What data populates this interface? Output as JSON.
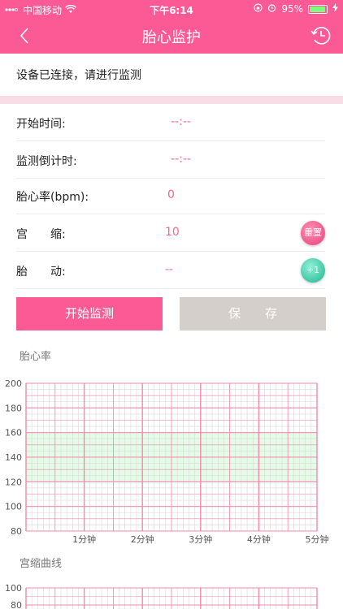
{
  "status_bar": {
    "carrier": "中国移动",
    "time": "下午6:14",
    "battery_percent": "95%",
    "battery_level": 0.95
  },
  "nav": {
    "title": "胎心监护",
    "back_icon": "chevron-left-icon",
    "history_icon": "history-clock-icon"
  },
  "notice": "设备已连接，请进行监测",
  "rows": [
    {
      "label": "开始时间:",
      "value": "--:--"
    },
    {
      "label": "监测倒计时:",
      "value": "--:--"
    },
    {
      "label": "胎心率(bpm):",
      "value": "0"
    },
    {
      "label": "宫　　缩:",
      "value": "10",
      "action": "重置"
    },
    {
      "label": "胎　　动:",
      "value": "--",
      "action": "+1"
    }
  ],
  "buttons": {
    "start": "开始监测",
    "save": "保　　存"
  },
  "colors": {
    "accent": "#fb5a95",
    "save_bg": "#d5cfcc",
    "normal_band": "#e4fbe8",
    "grid_major": "#f08bab",
    "grid_minor": "#d9d9d9"
  },
  "chart_data": [
    {
      "type": "line",
      "title": "胎心率",
      "y_ticks": [
        "200",
        "180",
        "160",
        "140",
        "120",
        "100",
        "80"
      ],
      "ylim": [
        80,
        200
      ],
      "x_ticks": [
        "1分钟",
        "2分钟",
        "3分钟",
        "4分钟",
        "5分钟"
      ],
      "xlim": [
        0,
        5
      ],
      "normal_band": [
        120,
        160
      ],
      "series": []
    },
    {
      "type": "line",
      "title": "宫缩曲线",
      "y_ticks": [
        "100",
        "80"
      ],
      "ylim": [
        0,
        100
      ],
      "series": []
    }
  ]
}
